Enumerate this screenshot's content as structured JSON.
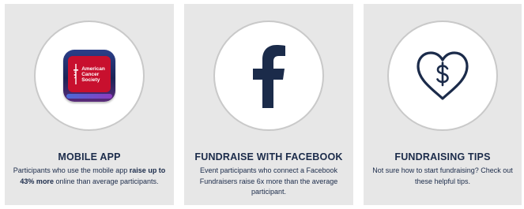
{
  "colors": {
    "navy": "#1b2b4a",
    "card_bg": "#e7e7e7",
    "brand_red": "#c8102e"
  },
  "cards": [
    {
      "icon": "american-cancer-society-app-icon",
      "logo_text": [
        "American",
        "Cancer",
        "Society"
      ],
      "title": "MOBILE APP",
      "desc_pre": "Participants who use the mobile app",
      "desc_bold": "raise up to 43% more",
      "desc_post": "online than average participants."
    },
    {
      "icon": "facebook-icon",
      "title": "FUNDRAISE WITH FACEBOOK",
      "desc": "Event participants who connect a Facebook Fundraisers raise 6x more than the average participant."
    },
    {
      "icon": "heart-dollar-icon",
      "title": "FUNDRAISING TIPS",
      "desc": "Not sure how to start fundraising? Check out these helpful tips."
    }
  ]
}
